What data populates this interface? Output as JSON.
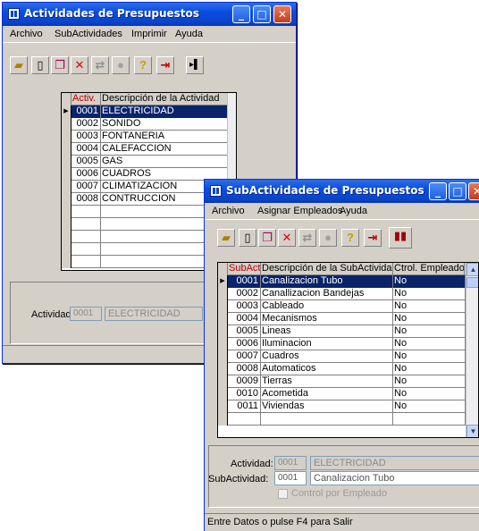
{
  "win1": {
    "title": "Actividades de Presupuestos",
    "menu": {
      "archivo": "Archivo",
      "subactividades": "SubActividades",
      "imprimir": "Imprimir",
      "ayuda": "Ayuda"
    },
    "columns": {
      "code": "Activ.",
      "desc": "Descripción de la Actividad"
    },
    "rows": [
      {
        "code": "0001",
        "desc": "ELECTRICIDAD"
      },
      {
        "code": "0002",
        "desc": "SONIDO"
      },
      {
        "code": "0003",
        "desc": "FONTANERIA"
      },
      {
        "code": "0004",
        "desc": "CALEFACCION"
      },
      {
        "code": "0005",
        "desc": "GAS"
      },
      {
        "code": "0006",
        "desc": "CUADROS"
      },
      {
        "code": "0007",
        "desc": "CLIMATIZACION"
      },
      {
        "code": "0008",
        "desc": "CONTRUCCION"
      }
    ],
    "actividad_label": "Actividad:",
    "actividad_code": "0001",
    "actividad_desc": "ELECTRICIDAD"
  },
  "win2": {
    "title": "SubActividades de Presupuestos",
    "menu": {
      "archivo": "Archivo",
      "asignar": "Asignar Empleados",
      "ayuda": "Ayuda"
    },
    "columns": {
      "code": "SubAct.",
      "desc": "Descripción de la SubActividad",
      "ctrl": "Ctrol. Empleado"
    },
    "rows": [
      {
        "code": "0001",
        "desc": "Canalizacion Tubo",
        "ctrl": "No"
      },
      {
        "code": "0002",
        "desc": "Canallizacion Bandejas",
        "ctrl": "No"
      },
      {
        "code": "0003",
        "desc": "Cableado",
        "ctrl": "No"
      },
      {
        "code": "0004",
        "desc": "Mecanismos",
        "ctrl": "No"
      },
      {
        "code": "0005",
        "desc": "Lineas",
        "ctrl": "No"
      },
      {
        "code": "0006",
        "desc": "Iluminacion",
        "ctrl": "No"
      },
      {
        "code": "0007",
        "desc": "Cuadros",
        "ctrl": "No"
      },
      {
        "code": "0008",
        "desc": "Automaticos",
        "ctrl": "No"
      },
      {
        "code": "0009",
        "desc": "Tierras",
        "ctrl": "No"
      },
      {
        "code": "0010",
        "desc": "Acometida",
        "ctrl": "No"
      },
      {
        "code": "0011",
        "desc": "Viviendas",
        "ctrl": "No"
      }
    ],
    "actividad_label": "Actividad:",
    "actividad_code": "0001",
    "actividad_desc": "ELECTRICIDAD",
    "subactividad_label": "SubActividad:",
    "subactividad_code": "0001",
    "subactividad_desc": "Canalizacion Tubo",
    "control_label": "Control por Empleado",
    "status": "Entre Datos o pulse F4 para Salir"
  },
  "colors": {
    "title_blue": "#0a44c8",
    "selection": "#0a246a",
    "header_red": "#c00000"
  }
}
